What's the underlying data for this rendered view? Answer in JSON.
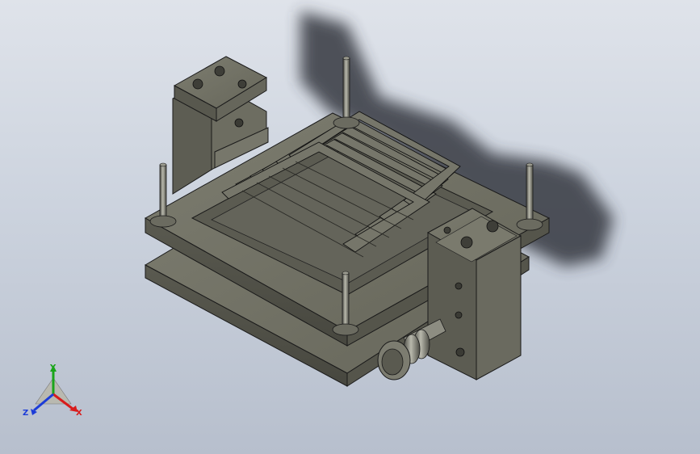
{
  "viewport": {
    "background_top": "#dfe3ea",
    "background_bottom": "#b7bfcd"
  },
  "model": {
    "part_color": "#6f6f63",
    "part_highlight": "#8a8a7c",
    "part_shadow": "#4d4d44",
    "edge_color": "#1a1a1a",
    "shadow_color": "#3a3f46"
  },
  "triad": {
    "x_label": "X",
    "y_label": "Y",
    "z_label": "Z",
    "x_color": "#d81c1c",
    "y_color": "#1aa51a",
    "z_color": "#1c3cd8"
  }
}
